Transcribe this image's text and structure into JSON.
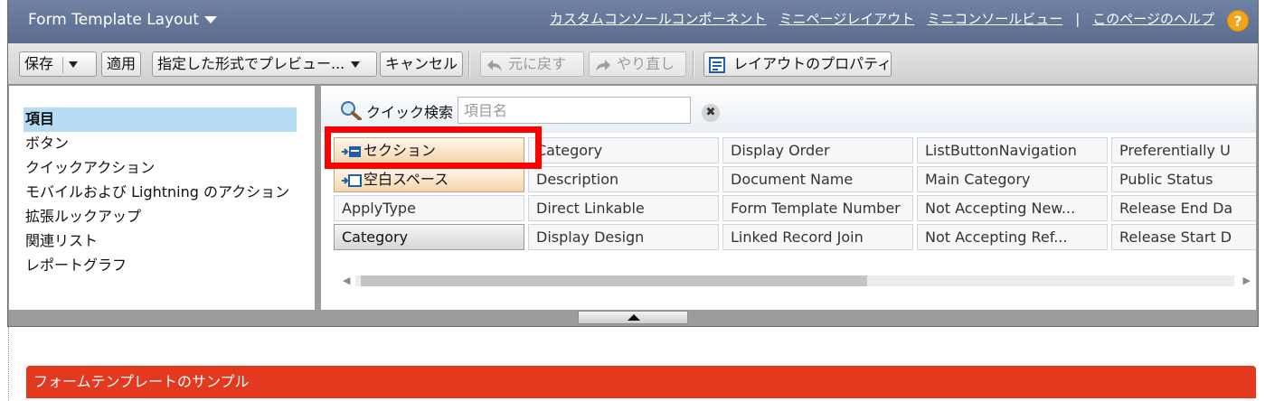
{
  "header": {
    "title": "Form Template Layout",
    "links": [
      "カスタムコンソールコンポーネント",
      "ミニページレイアウト",
      "ミニコンソールビュー",
      "このページのヘルプ"
    ],
    "separator": "|",
    "help_glyph": "?"
  },
  "toolbar": {
    "save": "保存",
    "apply": "適用",
    "preview": "指定した形式でプレビュー...",
    "cancel": "キャンセル",
    "undo": "元に戻す",
    "redo": "やり直し",
    "layout_props": "レイアウトのプロパティ"
  },
  "palette": {
    "categories": [
      "項目",
      "ボタン",
      "クイックアクション",
      "モバイルおよび Lightning のアクション",
      "拡張ルックアップ",
      "関連リスト",
      "レポートグラフ"
    ],
    "active_category": "項目"
  },
  "quick_find": {
    "label": "クイック検索",
    "placeholder": "項目名",
    "clear_glyph": "✖"
  },
  "fields": {
    "col1": [
      "セクション",
      "空白スペース",
      "ApplyType",
      "Category"
    ],
    "col2": [
      "Category",
      "Description",
      "Direct Linkable",
      "Display Design"
    ],
    "col3": [
      "Display Order",
      "Document Name",
      "Form Template Number",
      "Linked Record Join"
    ],
    "col4": [
      "ListButtonNavigation",
      "Main Category",
      "Not Accepting New...",
      "Not Accepting Ref..."
    ],
    "col5": [
      "Preferentially U",
      "Public Status",
      "Release End Da",
      "Release Start D"
    ]
  },
  "section_header": "フォームテンプレートのサンプル",
  "colors": {
    "title_bar": "#5a6d8f",
    "section_bar": "#e4391f",
    "highlight": "#ff0000",
    "help": "#f1a51a",
    "active_category": "#b6dcf5"
  }
}
